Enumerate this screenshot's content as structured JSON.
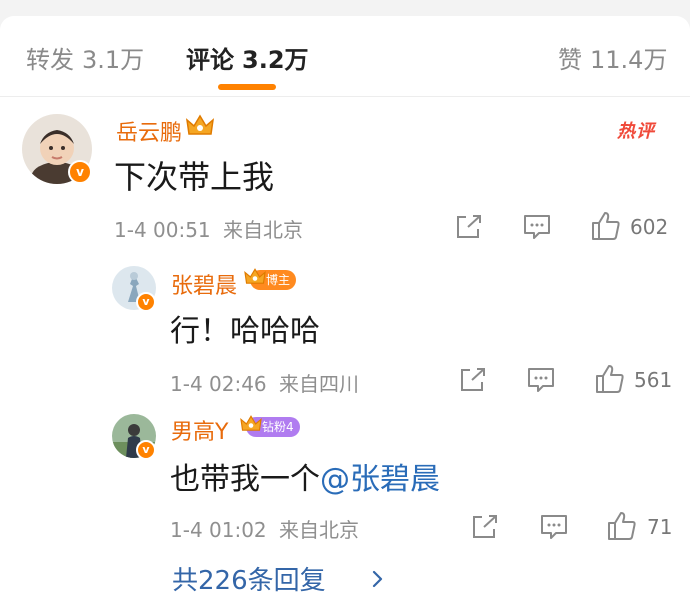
{
  "tabs": {
    "repost": {
      "label": "转发",
      "count": "3.1万"
    },
    "comment": {
      "label": "评论",
      "count": "3.2万"
    },
    "like": {
      "label": "赞",
      "count": "11.4万"
    }
  },
  "comments": [
    {
      "username": "岳云鹏",
      "text": "下次带上我",
      "time": "1-4 00:51",
      "location": "来自北京",
      "likes": "602",
      "hot_badge": "热评",
      "verified_badge": "v"
    }
  ],
  "replies": [
    {
      "username": "张碧晨",
      "tag": "博主",
      "text": "行！哈哈哈",
      "time": "1-4 02:46",
      "location": "来自四川",
      "likes": "561",
      "verified_badge": "v"
    },
    {
      "username": "男高Y",
      "tag": "钻粉4",
      "text": "也带我一个",
      "mention": "@张碧晨",
      "time": "1-4 01:02",
      "location": "来自北京",
      "likes": "71",
      "verified_badge": "v"
    }
  ],
  "more_replies": "共226条回复",
  "colors": {
    "accent": "#ff8200",
    "username": "#e86b0c",
    "mention": "#2a6cb8",
    "tag_blogger": "#ff8a1f",
    "tag_fan": "#b07cf0",
    "hot": "#f04a3a"
  },
  "icons": [
    "crown-icon",
    "share-icon",
    "comment-icon",
    "thumbs-up-icon",
    "chevron-right-icon"
  ]
}
